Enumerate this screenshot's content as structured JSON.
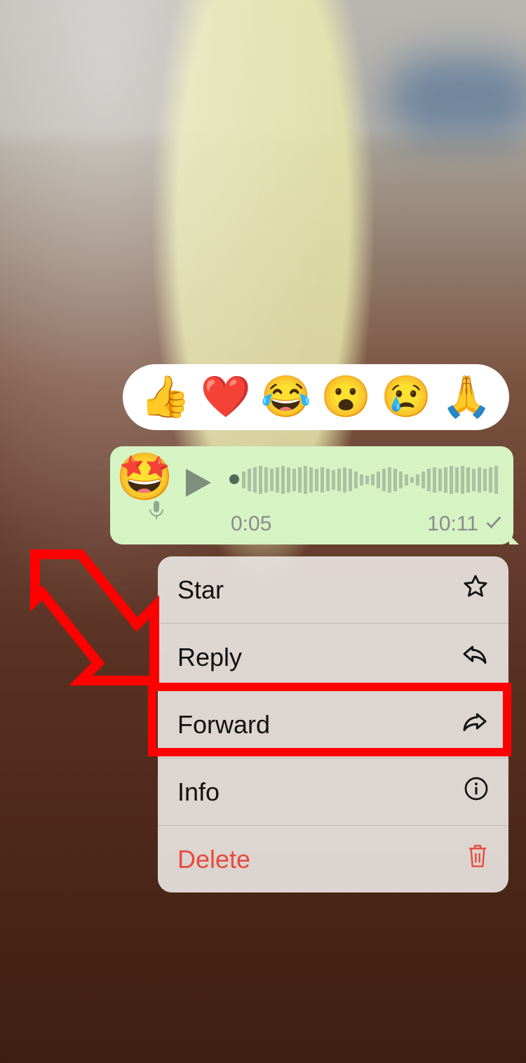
{
  "reactions": [
    "👍",
    "❤️",
    "😂",
    "😮",
    "😢",
    "🙏"
  ],
  "bubble": {
    "avatar": "🤩",
    "duration": "0:05",
    "time": "10:11"
  },
  "menu": {
    "star": "Star",
    "reply": "Reply",
    "forward": "Forward",
    "info": "Info",
    "delete": "Delete"
  }
}
